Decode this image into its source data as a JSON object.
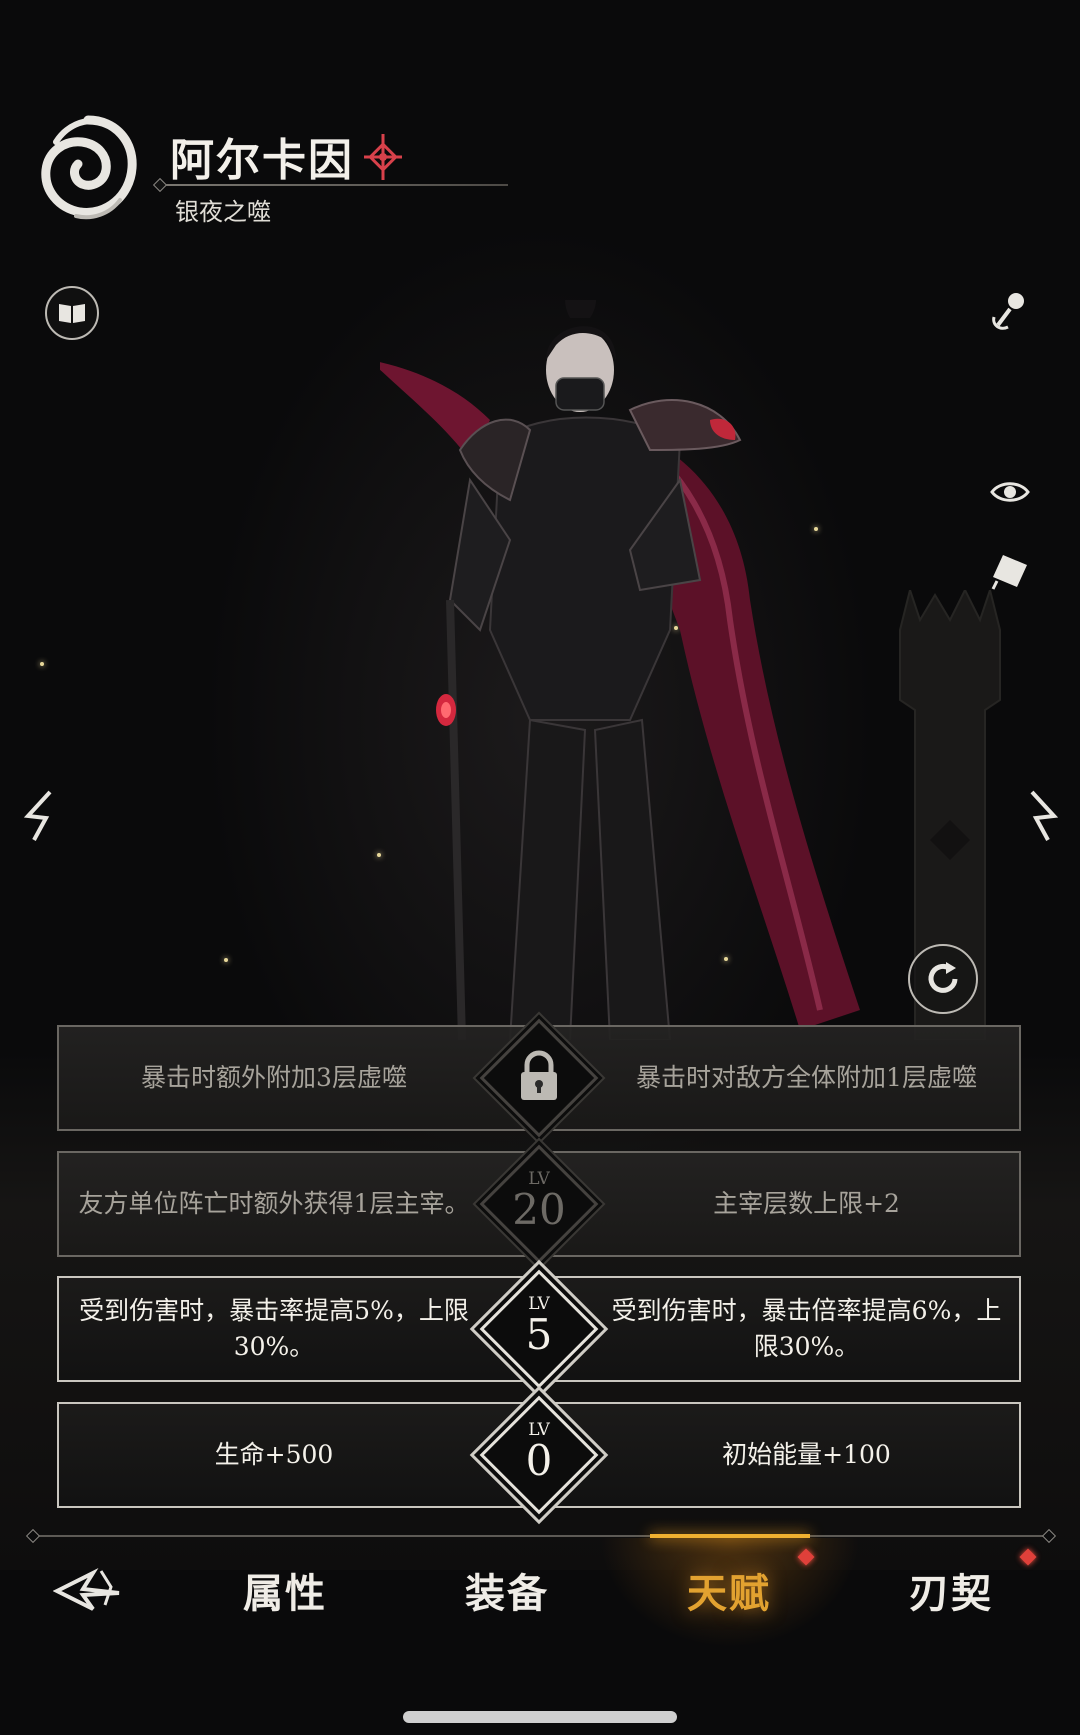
{
  "character": {
    "name": "阿尔卡因",
    "subtitle": "银夜之噬"
  },
  "talents": [
    {
      "left": "暴击时额外附加3层虚噬",
      "right": "暴击时对敌方全体附加1层虚噬",
      "badge_type": "locked",
      "badge_level": ""
    },
    {
      "left": "友方单位阵亡时额外获得1层主宰。",
      "right": "主宰层数上限+2",
      "badge_type": "level",
      "badge_label": "LV",
      "badge_level": "20"
    },
    {
      "left": "受到伤害时，暴击率提高5%，上限30%。",
      "right": "受到伤害时，暴击倍率提高6%，上限30%。",
      "badge_type": "level",
      "badge_label": "LV",
      "badge_level": "5"
    },
    {
      "left": "生命+500",
      "right": "初始能量+100",
      "badge_type": "level",
      "badge_label": "LV",
      "badge_level": "0"
    }
  ],
  "nav": {
    "tabs": [
      {
        "label": "属性",
        "active": false,
        "badge": false
      },
      {
        "label": "装备",
        "active": false,
        "badge": false
      },
      {
        "label": "天赋",
        "active": true,
        "badge": true
      },
      {
        "label": "刃契",
        "active": false,
        "badge": true
      }
    ]
  },
  "colors": {
    "accent_active_tab": "#e2a230",
    "notification_dot": "#e0403a",
    "cape_crimson": "#6e1530"
  },
  "icons": {
    "emblem": "swirl-emblem-icon",
    "faction": "red-knot-icon",
    "codex": "book-icon",
    "customize": "pin-icon",
    "view": "eye-icon",
    "note": "tag-icon",
    "prev": "prev-arrow-icon",
    "next": "next-arrow-icon",
    "rotate": "rotate-icon",
    "lock": "lock-icon",
    "back": "back-icon"
  }
}
